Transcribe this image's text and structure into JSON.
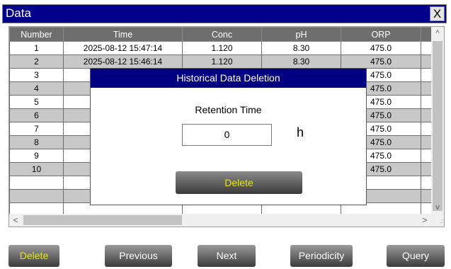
{
  "window": {
    "title": "Data",
    "close_label": "X"
  },
  "table": {
    "headers": [
      "Number",
      "Time",
      "Conc",
      "pH",
      "ORP"
    ],
    "rows": [
      [
        "1",
        "2025-08-12 15:47:14",
        "1.120",
        "8.30",
        "475.0"
      ],
      [
        "2",
        "2025-08-12 15:46:14",
        "1.120",
        "8.30",
        "475.0"
      ],
      [
        "3",
        "20",
        "",
        "",
        "475.0"
      ],
      [
        "4",
        "20",
        "",
        "",
        "475.0"
      ],
      [
        "5",
        "20",
        "",
        "",
        "475.0"
      ],
      [
        "6",
        "20",
        "",
        "",
        "475.0"
      ],
      [
        "7",
        "20",
        "",
        "",
        "475.0"
      ],
      [
        "8",
        "20",
        "",
        "",
        "475.0"
      ],
      [
        "9",
        "20",
        "",
        "",
        "475.0"
      ],
      [
        "10",
        "20",
        "",
        "",
        "475.0"
      ],
      [
        "",
        "",
        "",
        "",
        ""
      ],
      [
        "",
        "",
        "",
        "",
        ""
      ],
      [
        "",
        "",
        "",
        "",
        ""
      ]
    ]
  },
  "scroll": {
    "up": "^",
    "down": "v",
    "left": "<",
    "right": ">",
    "grip": ".::"
  },
  "dialog": {
    "title": "Historical Data Deletion",
    "label": "Retention Time",
    "value": "0",
    "unit": "h",
    "button": "Delete"
  },
  "buttons": {
    "delete": "Delete",
    "previous": "Previous",
    "next": "Next",
    "periodicity": "Periodicity",
    "query": "Query"
  }
}
